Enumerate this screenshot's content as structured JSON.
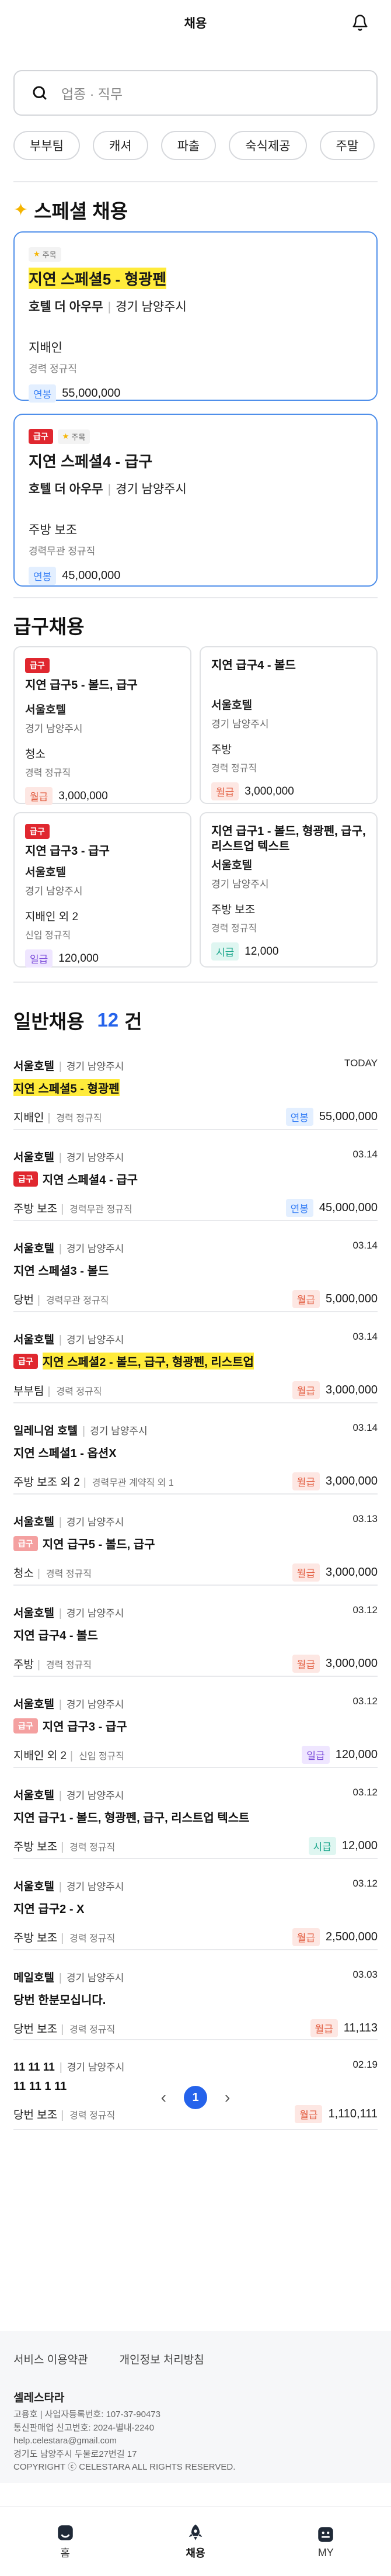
{
  "header": {
    "title": "채용"
  },
  "search": {
    "placeholder": "업종 · 직무"
  },
  "chips": [
    "부부팀",
    "캐셔",
    "파출",
    "숙식제공",
    "주말"
  ],
  "special": {
    "title": "스페셜 채용",
    "items": [
      {
        "badges": {
          "urgent": "",
          "star": "주목"
        },
        "title": "지연 스페셜5 - 형광펜",
        "company": "호텔 더 아우무",
        "location": "경기 남양주시",
        "job": "지배인",
        "career": "경력 정규직",
        "pay_type": "연봉",
        "pay": "55,000,000"
      },
      {
        "badges": {
          "urgent": "급구",
          "star": "주목"
        },
        "title": "지연 스페셜4 - 급구",
        "company": "호텔 더 아우무",
        "location": "경기 남양주시",
        "job": "주방 보조",
        "career": "경력무관 정규직",
        "pay_type": "연봉",
        "pay": "45,000,000"
      }
    ]
  },
  "urgent": {
    "title": "급구채용",
    "items": [
      {
        "badge": "급구",
        "title": "지연 급구5 - 볼드, 급구",
        "company": "서울호텔",
        "location": "경기 남양주시",
        "job": "청소",
        "career": "경력 정규직",
        "pay_type": "월급",
        "pay": "3,000,000"
      },
      {
        "badge": "",
        "title": "지연 급구4 - 볼드",
        "company": "서울호텔",
        "location": "경기 남양주시",
        "job": "주방",
        "career": "경력 정규직",
        "pay_type": "월급",
        "pay": "3,000,000"
      },
      {
        "badge": "급구",
        "title": "지연 급구3 - 급구",
        "company": "서울호텔",
        "location": "경기 남양주시",
        "job": "지배인 외 2",
        "career": "신입 정규직",
        "pay_type": "일급",
        "pay": "120,000"
      },
      {
        "badge": "",
        "title": "지연 급구1 - 볼드, 형광펜, 급구, 리스트업 텍스트",
        "company": "서울호텔",
        "location": "경기 남양주시",
        "job": "주방 보조",
        "career": "경력 정규직",
        "pay_type": "시급",
        "pay": "12,000"
      }
    ]
  },
  "general": {
    "title": "일반채용",
    "count": "12",
    "count_suffix": "건",
    "items": [
      {
        "company": "서울호텔",
        "location": "경기 남양주시",
        "date": "TODAY",
        "badge": "",
        "title": "지연 스페셜5 - 형광펜",
        "highlight": true,
        "job": "지배인",
        "career": "경력 정규직",
        "pay_type": "연봉",
        "pay": "55,000,000"
      },
      {
        "company": "서울호텔",
        "location": "경기 남양주시",
        "date": "03.14",
        "badge": "급구",
        "title": "지연 스페셜4 - 급구",
        "highlight": false,
        "job": "주방 보조",
        "career": "경력무관 정규직",
        "pay_type": "연봉",
        "pay": "45,000,000"
      },
      {
        "company": "서울호텔",
        "location": "경기 남양주시",
        "date": "03.14",
        "badge": "",
        "title": "지연 스페셜3 - 볼드",
        "highlight": false,
        "job": "당번",
        "career": "경력무관 정규직",
        "pay_type": "월급",
        "pay": "5,000,000"
      },
      {
        "company": "서울호텔",
        "location": "경기 남양주시",
        "date": "03.14",
        "badge": "급구",
        "title": "지연 스페셜2 - 볼드, 급구, 형광펜, 리스트업",
        "highlight": true,
        "job": "부부팀",
        "career": "경력 정규직",
        "pay_type": "월급",
        "pay": "3,000,000"
      },
      {
        "company": "일레니엄 호텔",
        "location": "경기 남양주시",
        "date": "03.14",
        "badge": "",
        "title": "지연 스페셜1 - 옵션X",
        "highlight": false,
        "job": "주방 보조 외 2",
        "career": "경력무관 계약직 외 1",
        "pay_type": "월급",
        "pay": "3,000,000"
      },
      {
        "company": "서울호텔",
        "location": "경기 남양주시",
        "date": "03.13",
        "badge": "급구",
        "badge_light": true,
        "title": "지연 급구5 - 볼드, 급구",
        "highlight": false,
        "job": "청소",
        "career": "경력 정규직",
        "pay_type": "월급",
        "pay": "3,000,000"
      },
      {
        "company": "서울호텔",
        "location": "경기 남양주시",
        "date": "03.12",
        "badge": "",
        "title": "지연 급구4 - 볼드",
        "highlight": false,
        "job": "주방",
        "career": "경력 정규직",
        "pay_type": "월급",
        "pay": "3,000,000"
      },
      {
        "company": "서울호텔",
        "location": "경기 남양주시",
        "date": "03.12",
        "badge": "급구",
        "badge_light": true,
        "title": "지연 급구3 - 급구",
        "highlight": false,
        "job": "지배인 외 2",
        "career": "신입 정규직",
        "pay_type": "일급",
        "pay": "120,000"
      },
      {
        "company": "서울호텔",
        "location": "경기 남양주시",
        "date": "03.12",
        "badge": "",
        "title": "지연 급구1 - 볼드, 형광펜, 급구, 리스트업 텍스트",
        "highlight": false,
        "job": "주방 보조",
        "career": "경력 정규직",
        "pay_type": "시급",
        "pay": "12,000"
      },
      {
        "company": "서울호텔",
        "location": "경기 남양주시",
        "date": "03.12",
        "badge": "",
        "title": "지연 급구2 - X",
        "highlight": false,
        "job": "주방 보조",
        "career": "경력 정규직",
        "pay_type": "월급",
        "pay": "2,500,000"
      },
      {
        "company": "메일호텔",
        "location": "경기 남양주시",
        "date": "03.03",
        "badge": "",
        "title": "당번 한분모십니다.",
        "highlight": false,
        "job": "당번 보조",
        "career": "경력 정규직",
        "pay_type": "월급",
        "pay": "11,113"
      },
      {
        "company": "11 11 11",
        "location": "경기 남양주시",
        "date": "02.19",
        "badge": "",
        "title": "11 11 1 11",
        "highlight": false,
        "job": "당번 보조",
        "career": "경력 정규직",
        "pay_type": "월급",
        "pay": "1,110,111"
      }
    ]
  },
  "pagination": {
    "current": "1",
    "prev": "‹",
    "next": "›"
  },
  "footer": {
    "links": [
      "서비스 이용약관",
      "개인정보 처리방침"
    ],
    "brand": "셀레스타라",
    "info": [
      "고용호 | 사업자등록번호: 107-37-90473",
      "통신판매업 신고번호: 2024-별내-2240",
      "help.celestara@gmail.com",
      "경기도 남양주시 두물로27번길 17",
      "COPYRIGHT ⓒ CELESTARA ALL RIGHTS RESERVED."
    ]
  },
  "tabbar": {
    "items": [
      "홈",
      "채용",
      "MY"
    ],
    "active": "채용"
  },
  "colors": {
    "accent": "#2563eb",
    "urgent": "#e0272f",
    "highlight": "#ffeb3b",
    "special_border": "#4f8fea"
  }
}
